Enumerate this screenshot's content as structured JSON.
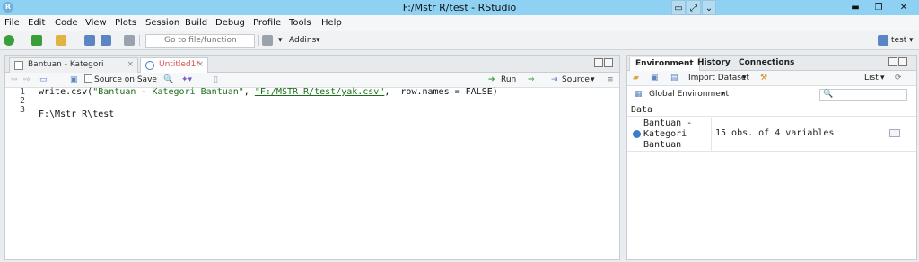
{
  "window": {
    "title": "F:/Mstr R/test - RStudio",
    "app_icon": "R"
  },
  "menu": [
    "File",
    "Edit",
    "Code",
    "View",
    "Plots",
    "Session",
    "Build",
    "Debug",
    "Profile",
    "Tools",
    "Help"
  ],
  "toolbar": {
    "goto_placeholder": "Go to file/function",
    "addins_label": "Addins",
    "project_label": "test"
  },
  "editor": {
    "tabs": [
      {
        "label": "Bantuan - Kategori Bantuan",
        "active": false
      },
      {
        "label": "Untitled1*",
        "active": true
      }
    ],
    "source_on_save": "Source on Save",
    "run_label": "Run",
    "source_label": "Source",
    "code": {
      "l1": "1",
      "l2": "2",
      "l3": "3",
      "c1_pre": "write.csv(",
      "c1_s1": "\"Bantuan - Kategori Bantuan\"",
      "c1_mid": ", ",
      "c1_s2": "\"F:/MSTR R/test/yak.csv\"",
      "c1_post": ",  row.names = FALSE)"
    },
    "console_line": "F:\\Mstr R\\test"
  },
  "right": {
    "tabs": [
      "Environment",
      "History",
      "Connections"
    ],
    "import_label": "Import Dataset",
    "list_label": "List",
    "global_env": "Global Environment",
    "data_header": "Data",
    "rows": [
      {
        "name": "Bantuan -\nKategori\nBantuan",
        "value": "15 obs. of 4 variables"
      }
    ]
  }
}
